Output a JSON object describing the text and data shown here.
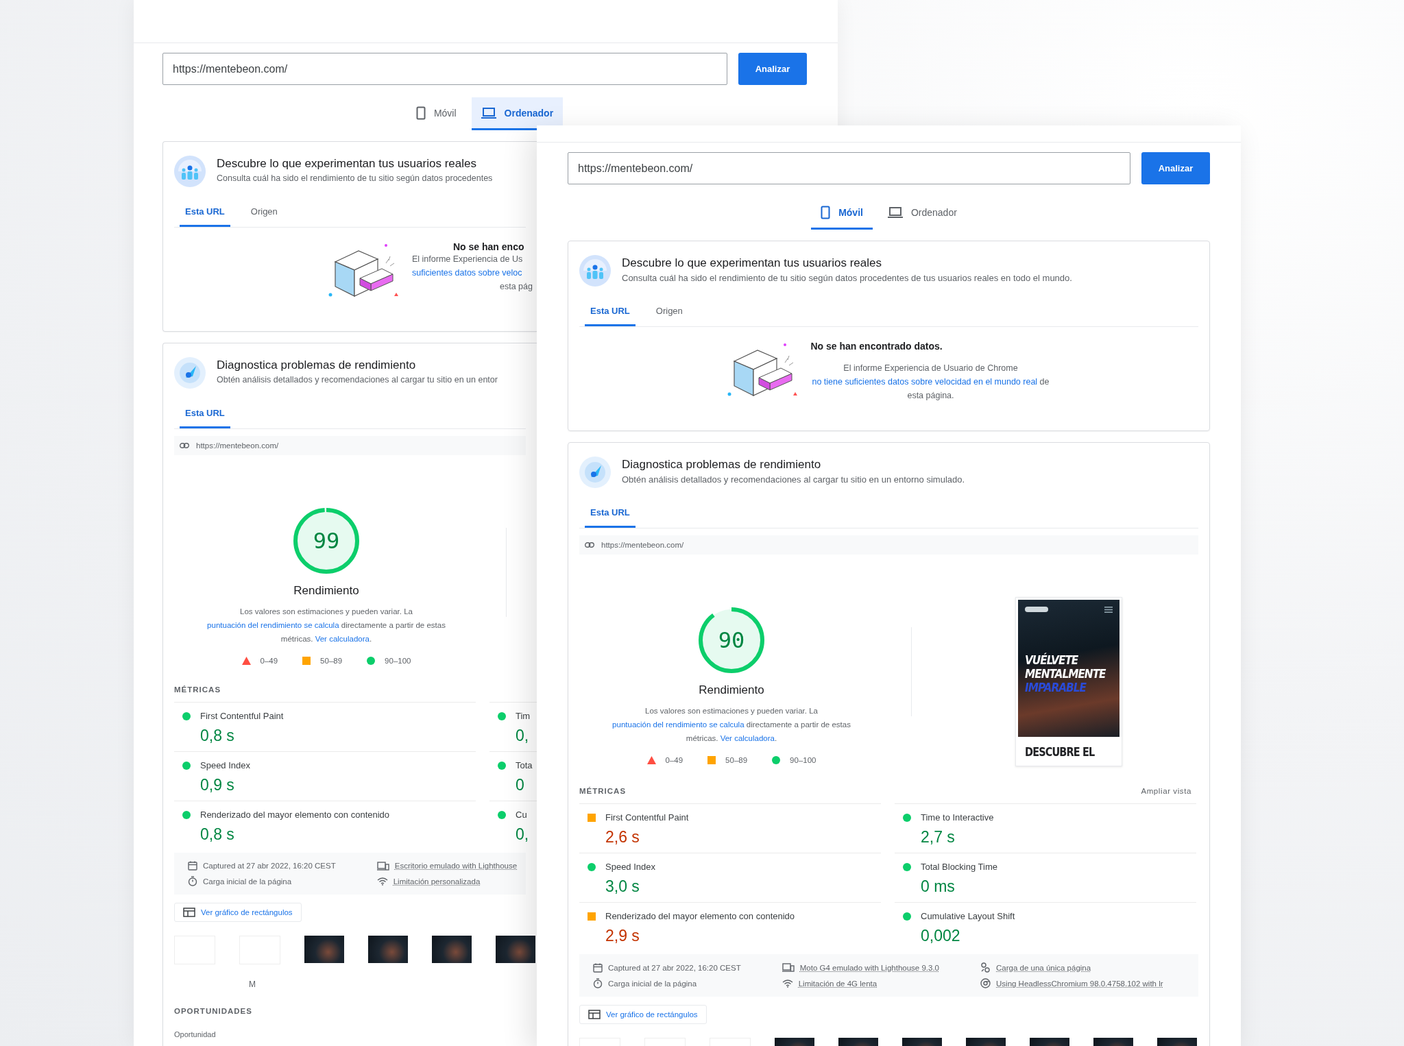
{
  "windows": [
    {
      "url_field": {
        "value": "https://mentebeon.com/"
      },
      "analyze_button": "Analizar",
      "device_tabs": [
        {
          "label": "Móvil",
          "kind": "phone",
          "selected": false,
          "hovered": false
        },
        {
          "label": "Ordenador",
          "kind": "laptop",
          "selected": true,
          "hovered": true
        }
      ],
      "field_data": {
        "title": "Descubre lo que experimentan tus usuarios reales",
        "subtitle": "Consulta cuál ha sido el rendimiento de tu sitio según datos procedentes",
        "tabs": [
          {
            "label": "Esta URL",
            "selected": true
          },
          {
            "label": "Origen",
            "selected": false
          }
        ],
        "message_title": "No se han enco",
        "message_parts": [
          {
            "kind": "text",
            "text": "El informe Experiencia de Us"
          },
          {
            "kind": "link",
            "text": "suficientes datos sobre veloc"
          },
          {
            "kind": "text",
            "text": "esta pág"
          }
        ]
      },
      "lab_data": {
        "title": "Diagnostica problemas de rendimiento",
        "subtitle": "Obtén análisis detallados y recomendaciones al cargar tu sitio en un entor",
        "tabs": [
          {
            "label": "Esta URL",
            "selected": true
          }
        ],
        "tested_url": "https://mentebeon.com/",
        "score": {
          "value": "99",
          "label": "Rendimiento"
        },
        "score_note": [
          {
            "kind": "text",
            "text": "Los valores son estimaciones y pueden variar. La "
          },
          {
            "kind": "link",
            "text": "puntuación del rendimiento se calcula"
          },
          {
            "kind": "text",
            "text": " directamente a partir de estas métricas. "
          },
          {
            "kind": "link",
            "text": "Ver calculadora"
          },
          {
            "kind": "text",
            "text": "."
          }
        ],
        "legend": [
          {
            "kind": "fail",
            "label": "0–49"
          },
          {
            "kind": "average",
            "label": "50–89"
          },
          {
            "kind": "pass",
            "label": "90–100"
          }
        ],
        "metrics_heading": "MÉTRICAS",
        "metrics": [
          {
            "name": "First Contentful Paint",
            "value": "0,8 s",
            "kind": "pass"
          },
          {
            "name": "Speed Index",
            "value": "0,9 s",
            "kind": "pass"
          },
          {
            "name": "Renderizado del mayor elemento con contenido",
            "value": "0,8 s",
            "kind": "pass"
          },
          {
            "name": "Tim",
            "value": "0,",
            "kind": "pass"
          },
          {
            "name": "Tota",
            "value": "0",
            "kind": "pass"
          },
          {
            "name": "Cu",
            "value": "0,",
            "kind": "pass"
          }
        ],
        "environment": [
          {
            "kind": "calendar",
            "text": "Captured at 27 abr 2022, 16:20 CEST"
          },
          {
            "kind": "timer",
            "text": "Carga inicial de la página"
          },
          {
            "kind": "device",
            "text": "Escritorio emulado with Lighthouse"
          },
          {
            "kind": "network",
            "text": "Limitación personalizada"
          }
        ],
        "treemap_button": "Ver gráfico de rectángulos",
        "filmstrip": [
          {
            "kind": "blank"
          },
          {
            "kind": "blank"
          },
          {
            "kind": "frame"
          },
          {
            "kind": "frame"
          },
          {
            "kind": "frame"
          },
          {
            "kind": "frame"
          }
        ],
        "filmstrip_caption": "M",
        "opportunities_heading": "OPORTUNIDADES",
        "opportunities_column": "Oportunidad"
      }
    },
    {
      "url_field": {
        "value": "https://mentebeon.com/"
      },
      "analyze_button": "Analizar",
      "device_tabs": [
        {
          "label": "Móvil",
          "kind": "phone",
          "selected": true,
          "hovered": false
        },
        {
          "label": "Ordenador",
          "kind": "laptop",
          "selected": false,
          "hovered": false
        }
      ],
      "field_data": {
        "title": "Descubre lo que experimentan tus usuarios reales",
        "subtitle": "Consulta cuál ha sido el rendimiento de tu sitio según datos procedentes de tus usuarios reales en todo el mundo.",
        "tabs": [
          {
            "label": "Esta URL",
            "selected": true
          },
          {
            "label": "Origen",
            "selected": false
          }
        ],
        "message_title": "No se han encontrado datos.",
        "message_parts": [
          {
            "kind": "text",
            "text": "El informe Experiencia de Usuario de Chrome "
          },
          {
            "kind": "link",
            "text": "no tiene suficientes datos sobre velocidad en el mundo real"
          },
          {
            "kind": "text",
            "text": " de esta página."
          }
        ]
      },
      "lab_data": {
        "title": "Diagnostica problemas de rendimiento",
        "subtitle": "Obtén análisis detallados y recomendaciones al cargar tu sitio en un entorno simulado.",
        "tabs": [
          {
            "label": "Esta URL",
            "selected": true
          }
        ],
        "tested_url": "https://mentebeon.com/",
        "score": {
          "value": "90",
          "label": "Rendimiento"
        },
        "score_note": [
          {
            "kind": "text",
            "text": "Los valores son estimaciones y pueden variar. La "
          },
          {
            "kind": "link",
            "text": "puntuación del rendimiento se calcula"
          },
          {
            "kind": "text",
            "text": " directamente a partir de estas métricas. "
          },
          {
            "kind": "link",
            "text": "Ver calculadora"
          },
          {
            "kind": "text",
            "text": "."
          }
        ],
        "legend": [
          {
            "kind": "fail",
            "label": "0–49"
          },
          {
            "kind": "average",
            "label": "50–89"
          },
          {
            "kind": "pass",
            "label": "90–100"
          }
        ],
        "screenshot": {
          "headline": [
            "VUÉLVETE",
            "MENTALMENTE",
            "IMPARABLE"
          ],
          "caption": "DESCUBRE EL"
        },
        "metrics_heading": "MÉTRICAS",
        "expand_link": "Ampliar vista",
        "metrics": [
          {
            "name": "First Contentful Paint",
            "value": "2,6 s",
            "kind": "average"
          },
          {
            "name": "Speed Index",
            "value": "3,0 s",
            "kind": "pass"
          },
          {
            "name": "Renderizado del mayor elemento con contenido",
            "value": "2,9 s",
            "kind": "average"
          },
          {
            "name": "Time to Interactive",
            "value": "2,7 s",
            "kind": "pass"
          },
          {
            "name": "Total Blocking Time",
            "value": "0 ms",
            "kind": "pass"
          },
          {
            "name": "Cumulative Layout Shift",
            "value": "0,002",
            "kind": "pass"
          }
        ],
        "environment": [
          {
            "kind": "calendar",
            "text": "Captured at 27 abr 2022, 16:20 CEST"
          },
          {
            "kind": "timer",
            "text": "Carga inicial de la página"
          },
          {
            "kind": "device",
            "text": "Moto G4 emulado with Lighthouse 9.3.0"
          },
          {
            "kind": "network",
            "text": "Limitación de 4G lenta"
          },
          {
            "kind": "pages",
            "text": "Carga de una única página"
          },
          {
            "kind": "browser",
            "text": "Using HeadlessChromium 98.0.4758.102 with lr"
          }
        ],
        "treemap_button": "Ver gráfico de rectángulos",
        "filmstrip": [
          {
            "kind": "blank"
          },
          {
            "kind": "blank"
          },
          {
            "kind": "blank"
          },
          {
            "kind": "frame"
          },
          {
            "kind": "frame"
          },
          {
            "kind": "frame"
          },
          {
            "kind": "frame"
          },
          {
            "kind": "frame"
          },
          {
            "kind": "frame"
          },
          {
            "kind": "frame"
          }
        ]
      }
    }
  ]
}
